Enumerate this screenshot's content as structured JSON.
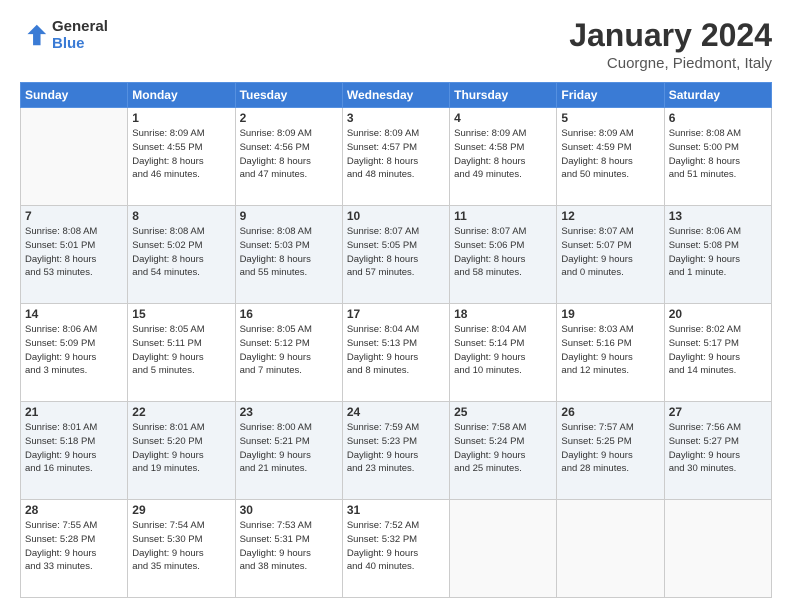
{
  "logo": {
    "line1": "General",
    "line2": "Blue"
  },
  "title": "January 2024",
  "subtitle": "Cuorgne, Piedmont, Italy",
  "weekdays": [
    "Sunday",
    "Monday",
    "Tuesday",
    "Wednesday",
    "Thursday",
    "Friday",
    "Saturday"
  ],
  "weeks": [
    [
      {
        "day": "",
        "info": ""
      },
      {
        "day": "1",
        "info": "Sunrise: 8:09 AM\nSunset: 4:55 PM\nDaylight: 8 hours\nand 46 minutes."
      },
      {
        "day": "2",
        "info": "Sunrise: 8:09 AM\nSunset: 4:56 PM\nDaylight: 8 hours\nand 47 minutes."
      },
      {
        "day": "3",
        "info": "Sunrise: 8:09 AM\nSunset: 4:57 PM\nDaylight: 8 hours\nand 48 minutes."
      },
      {
        "day": "4",
        "info": "Sunrise: 8:09 AM\nSunset: 4:58 PM\nDaylight: 8 hours\nand 49 minutes."
      },
      {
        "day": "5",
        "info": "Sunrise: 8:09 AM\nSunset: 4:59 PM\nDaylight: 8 hours\nand 50 minutes."
      },
      {
        "day": "6",
        "info": "Sunrise: 8:08 AM\nSunset: 5:00 PM\nDaylight: 8 hours\nand 51 minutes."
      }
    ],
    [
      {
        "day": "7",
        "info": "Sunrise: 8:08 AM\nSunset: 5:01 PM\nDaylight: 8 hours\nand 53 minutes."
      },
      {
        "day": "8",
        "info": "Sunrise: 8:08 AM\nSunset: 5:02 PM\nDaylight: 8 hours\nand 54 minutes."
      },
      {
        "day": "9",
        "info": "Sunrise: 8:08 AM\nSunset: 5:03 PM\nDaylight: 8 hours\nand 55 minutes."
      },
      {
        "day": "10",
        "info": "Sunrise: 8:07 AM\nSunset: 5:05 PM\nDaylight: 8 hours\nand 57 minutes."
      },
      {
        "day": "11",
        "info": "Sunrise: 8:07 AM\nSunset: 5:06 PM\nDaylight: 8 hours\nand 58 minutes."
      },
      {
        "day": "12",
        "info": "Sunrise: 8:07 AM\nSunset: 5:07 PM\nDaylight: 9 hours\nand 0 minutes."
      },
      {
        "day": "13",
        "info": "Sunrise: 8:06 AM\nSunset: 5:08 PM\nDaylight: 9 hours\nand 1 minute."
      }
    ],
    [
      {
        "day": "14",
        "info": "Sunrise: 8:06 AM\nSunset: 5:09 PM\nDaylight: 9 hours\nand 3 minutes."
      },
      {
        "day": "15",
        "info": "Sunrise: 8:05 AM\nSunset: 5:11 PM\nDaylight: 9 hours\nand 5 minutes."
      },
      {
        "day": "16",
        "info": "Sunrise: 8:05 AM\nSunset: 5:12 PM\nDaylight: 9 hours\nand 7 minutes."
      },
      {
        "day": "17",
        "info": "Sunrise: 8:04 AM\nSunset: 5:13 PM\nDaylight: 9 hours\nand 8 minutes."
      },
      {
        "day": "18",
        "info": "Sunrise: 8:04 AM\nSunset: 5:14 PM\nDaylight: 9 hours\nand 10 minutes."
      },
      {
        "day": "19",
        "info": "Sunrise: 8:03 AM\nSunset: 5:16 PM\nDaylight: 9 hours\nand 12 minutes."
      },
      {
        "day": "20",
        "info": "Sunrise: 8:02 AM\nSunset: 5:17 PM\nDaylight: 9 hours\nand 14 minutes."
      }
    ],
    [
      {
        "day": "21",
        "info": "Sunrise: 8:01 AM\nSunset: 5:18 PM\nDaylight: 9 hours\nand 16 minutes."
      },
      {
        "day": "22",
        "info": "Sunrise: 8:01 AM\nSunset: 5:20 PM\nDaylight: 9 hours\nand 19 minutes."
      },
      {
        "day": "23",
        "info": "Sunrise: 8:00 AM\nSunset: 5:21 PM\nDaylight: 9 hours\nand 21 minutes."
      },
      {
        "day": "24",
        "info": "Sunrise: 7:59 AM\nSunset: 5:23 PM\nDaylight: 9 hours\nand 23 minutes."
      },
      {
        "day": "25",
        "info": "Sunrise: 7:58 AM\nSunset: 5:24 PM\nDaylight: 9 hours\nand 25 minutes."
      },
      {
        "day": "26",
        "info": "Sunrise: 7:57 AM\nSunset: 5:25 PM\nDaylight: 9 hours\nand 28 minutes."
      },
      {
        "day": "27",
        "info": "Sunrise: 7:56 AM\nSunset: 5:27 PM\nDaylight: 9 hours\nand 30 minutes."
      }
    ],
    [
      {
        "day": "28",
        "info": "Sunrise: 7:55 AM\nSunset: 5:28 PM\nDaylight: 9 hours\nand 33 minutes."
      },
      {
        "day": "29",
        "info": "Sunrise: 7:54 AM\nSunset: 5:30 PM\nDaylight: 9 hours\nand 35 minutes."
      },
      {
        "day": "30",
        "info": "Sunrise: 7:53 AM\nSunset: 5:31 PM\nDaylight: 9 hours\nand 38 minutes."
      },
      {
        "day": "31",
        "info": "Sunrise: 7:52 AM\nSunset: 5:32 PM\nDaylight: 9 hours\nand 40 minutes."
      },
      {
        "day": "",
        "info": ""
      },
      {
        "day": "",
        "info": ""
      },
      {
        "day": "",
        "info": ""
      }
    ]
  ]
}
